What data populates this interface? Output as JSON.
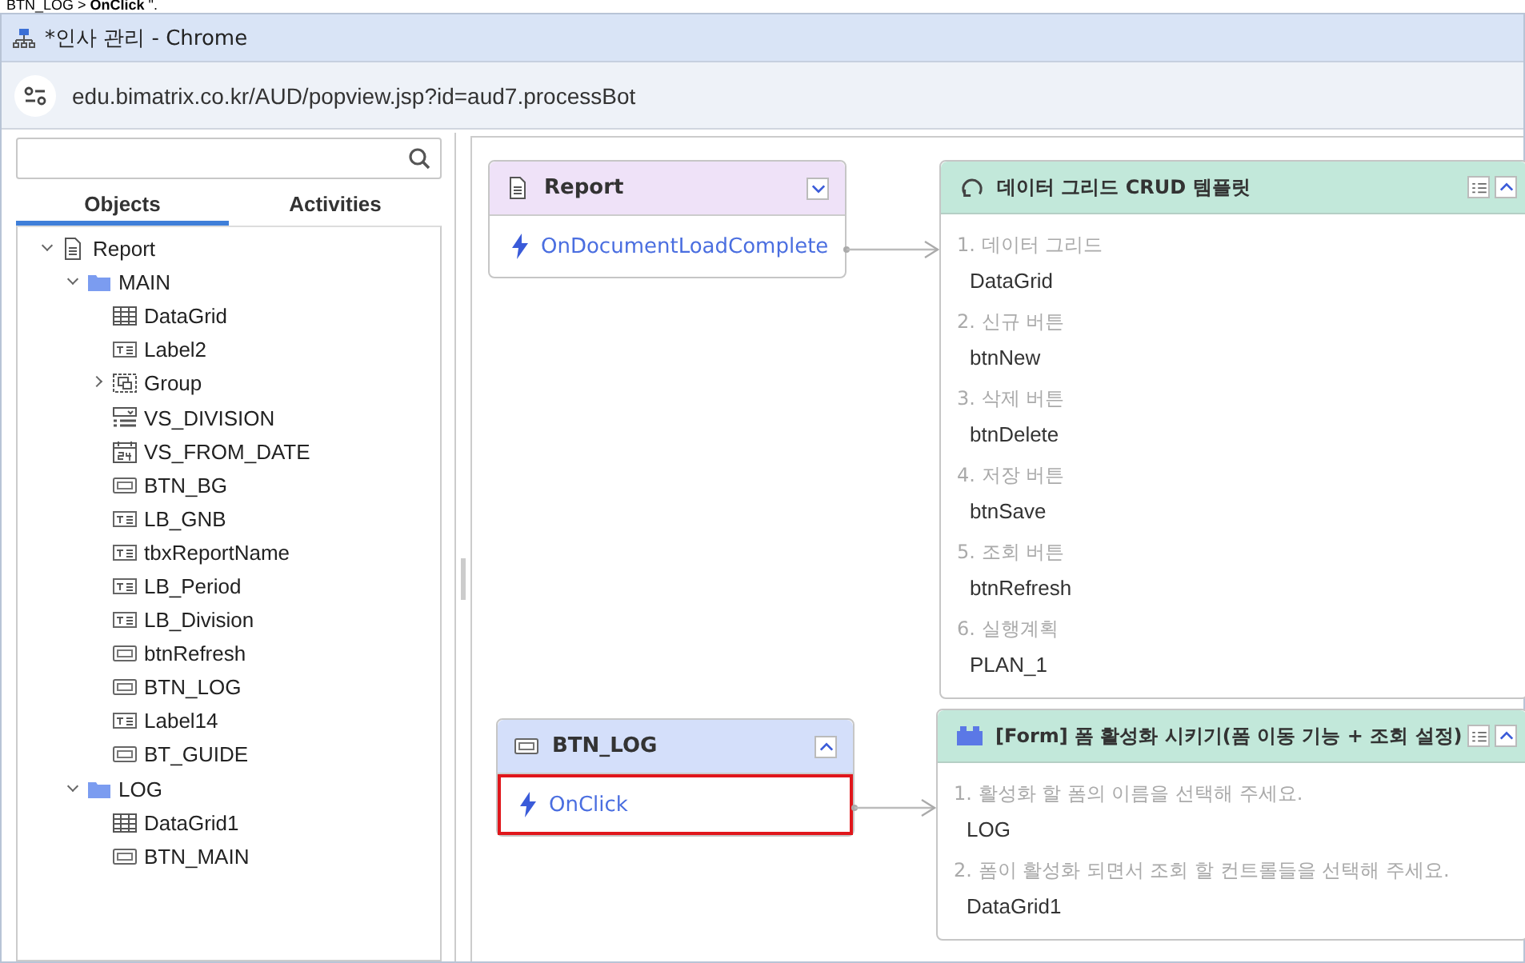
{
  "caption": "BTN_LOG > **OnClick** \".",
  "window": {
    "title": "*인사 관리 - Chrome"
  },
  "address_bar": {
    "url": "edu.bimatrix.co.kr/AUD/popview.jsp?id=aud7.processBot"
  },
  "sidebar": {
    "tabs": [
      {
        "label": "Objects",
        "selected": true
      },
      {
        "label": "Activities",
        "selected": false
      }
    ],
    "tree": [
      {
        "label": "Report",
        "kind": "document",
        "expanded": true,
        "children": [
          {
            "label": "MAIN",
            "kind": "folder",
            "expanded": true,
            "children": [
              {
                "label": "DataGrid",
                "kind": "grid"
              },
              {
                "label": "Label2",
                "kind": "label"
              },
              {
                "label": "Group",
                "kind": "group",
                "expanded": false
              },
              {
                "label": "VS_DIVISION",
                "kind": "combo"
              },
              {
                "label": "VS_FROM_DATE",
                "kind": "date"
              },
              {
                "label": "BTN_BG",
                "kind": "button"
              },
              {
                "label": "LB_GNB",
                "kind": "label"
              },
              {
                "label": "tbxReportName",
                "kind": "label"
              },
              {
                "label": "LB_Period",
                "kind": "label"
              },
              {
                "label": "LB_Division",
                "kind": "label"
              },
              {
                "label": "btnRefresh",
                "kind": "button"
              },
              {
                "label": "BTN_LOG",
                "kind": "button"
              },
              {
                "label": "Label14",
                "kind": "label"
              },
              {
                "label": "BT_GUIDE",
                "kind": "button"
              }
            ]
          },
          {
            "label": "LOG",
            "kind": "folder",
            "expanded": true,
            "children": [
              {
                "label": "DataGrid1",
                "kind": "grid"
              },
              {
                "label": "BTN_MAIN",
                "kind": "button"
              }
            ]
          }
        ]
      }
    ]
  },
  "canvas": {
    "event_nodes": [
      {
        "kind": "report",
        "title": "Report",
        "expanded": false,
        "events": [
          {
            "label": "OnDocumentLoadComplete",
            "selected": false
          }
        ]
      },
      {
        "kind": "button",
        "title": "BTN_LOG",
        "expanded": true,
        "events": [
          {
            "label": "OnClick",
            "selected": true
          }
        ]
      }
    ],
    "template_nodes": [
      {
        "kind": "crud",
        "title": "데이터 그리드  CRUD 템플릿",
        "params": [
          {
            "label": "1. 데이터 그리드",
            "value": "DataGrid"
          },
          {
            "label": "2. 신규 버튼",
            "value": "btnNew"
          },
          {
            "label": "3. 삭제 버튼",
            "value": "btnDelete"
          },
          {
            "label": "4. 저장 버튼",
            "value": "btnSave"
          },
          {
            "label": "5. 조회 버튼",
            "value": "btnRefresh"
          },
          {
            "label": "6. 실행계획",
            "value": "PLAN_1"
          }
        ]
      },
      {
        "kind": "form",
        "title": "[Form] 폼 활성화 시키기(폼 이동 기능 + 조회 설정)",
        "params": [
          {
            "label": "1. 활성화 할 폼의 이름을 선택해 주세요.",
            "value": "LOG"
          },
          {
            "label": "2. 폼이 활성화 되면서 조회 할 컨트롤들을 선택해 주세요.",
            "value": "DataGrid1"
          }
        ]
      }
    ]
  }
}
